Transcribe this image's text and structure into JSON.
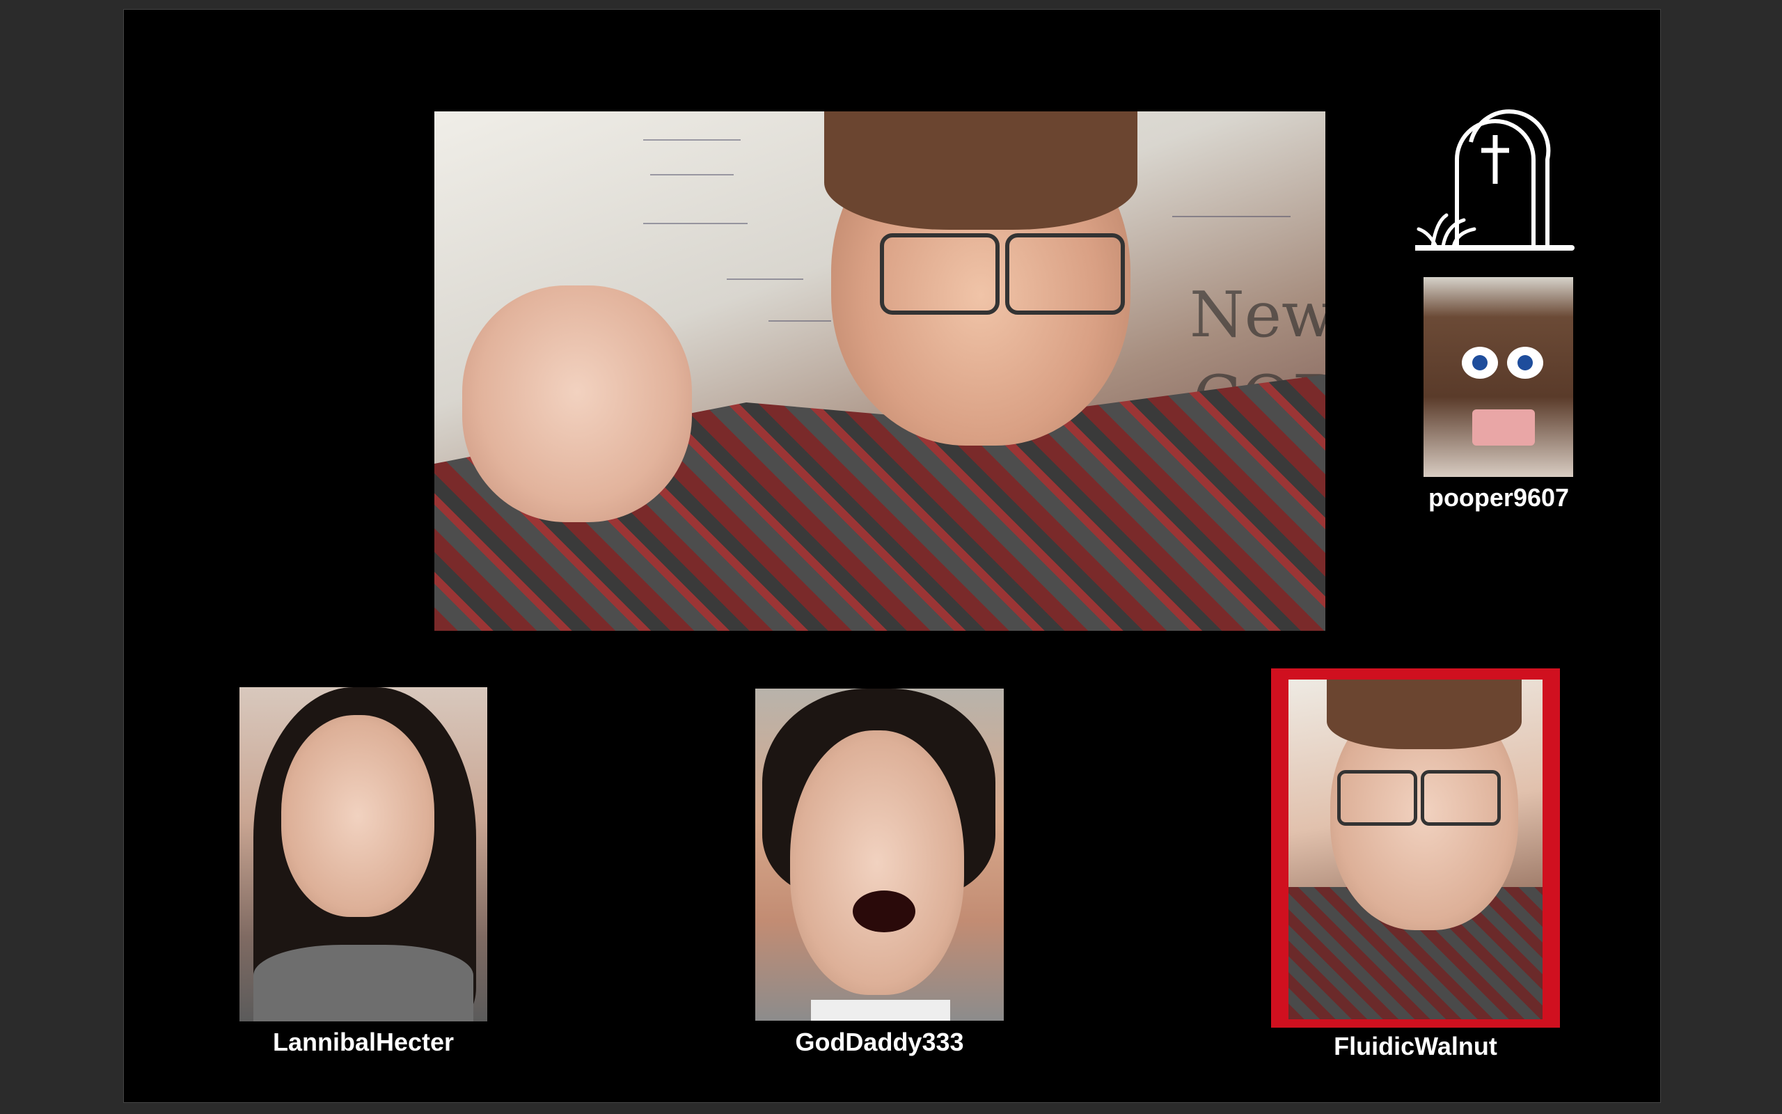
{
  "participants": {
    "main": {
      "name": "",
      "whiteboard_words": [
        "New",
        "COR"
      ]
    },
    "dead_player": {
      "name": "pooper9607",
      "icon": "tombstone-icon"
    },
    "players": [
      {
        "name": "LannibalHecter"
      },
      {
        "name": "GodDaddy333"
      },
      {
        "name": "FluidicWalnut",
        "highlighted": true,
        "highlight_color": "#d0101f"
      }
    ]
  },
  "colors": {
    "background": "#000000",
    "highlight": "#d0101f",
    "text": "#ffffff"
  }
}
